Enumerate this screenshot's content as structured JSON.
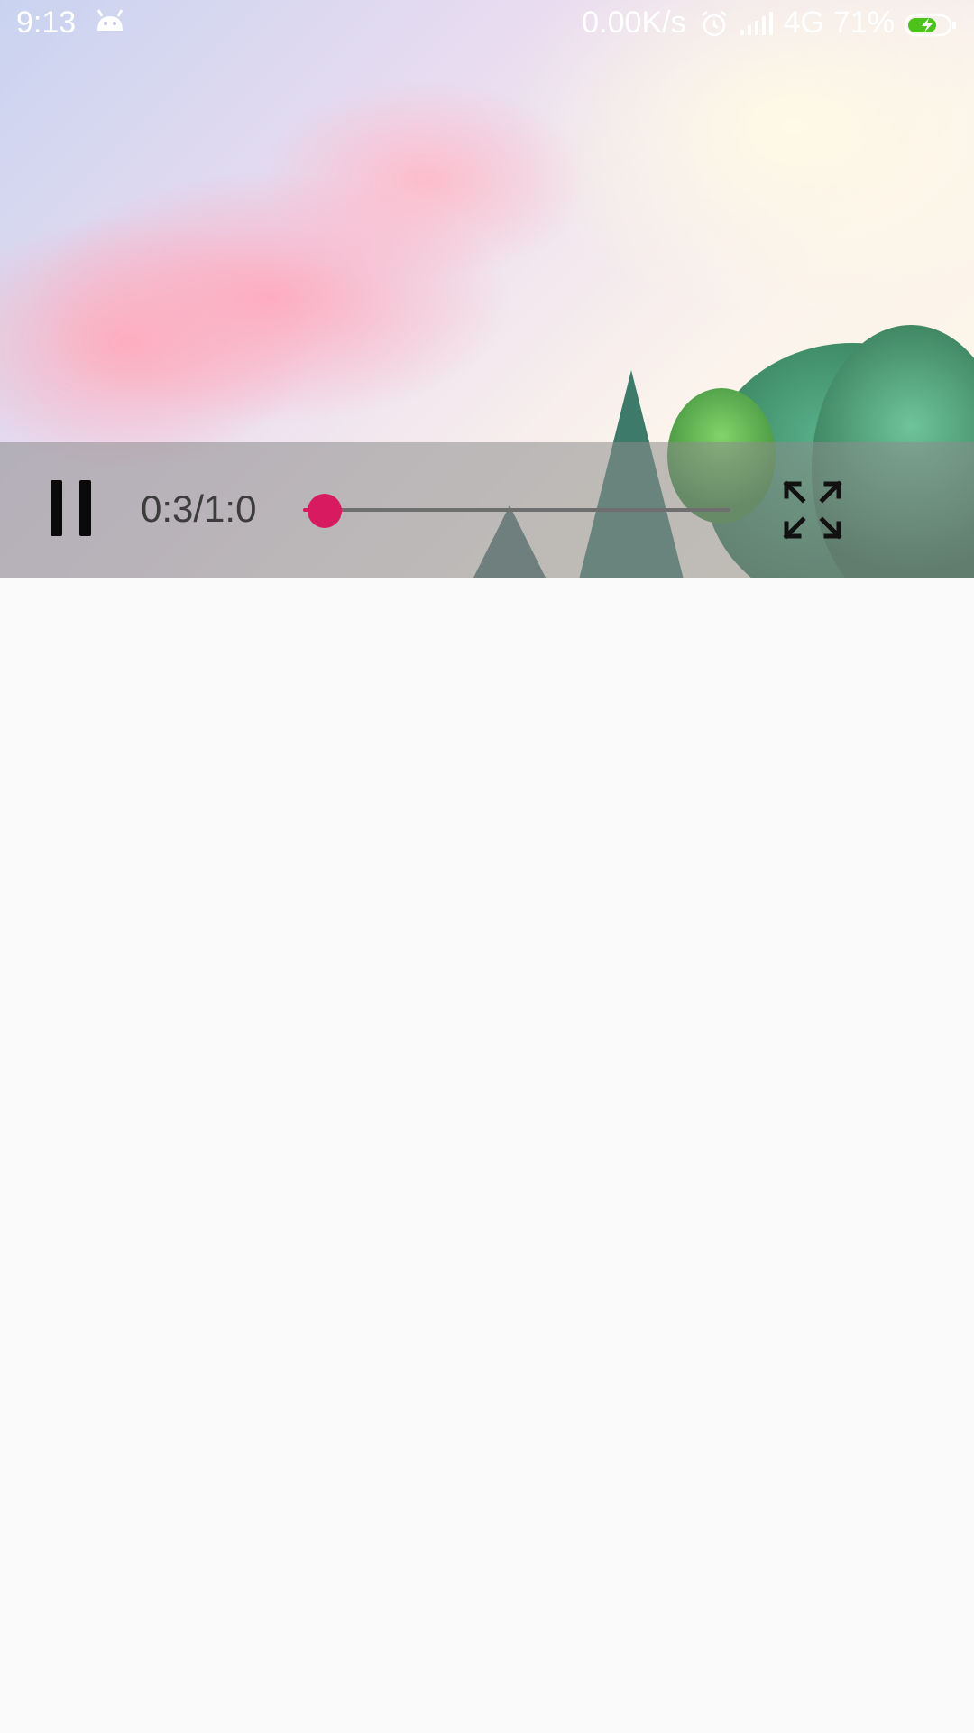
{
  "status_bar": {
    "time": "9:13",
    "network_speed": "0.00K/s",
    "network_type": "4G",
    "battery_percent": "71%",
    "battery_level": 0.71,
    "charging": true,
    "icons": [
      "android-notification-icon",
      "alarm-icon",
      "signal-icon",
      "battery-charging-icon"
    ]
  },
  "player": {
    "time_display": "0:3/1:0",
    "progress": 0.05,
    "play_state_icon": "pause-icon",
    "fullscreen_icon": "fullscreen-expand-icon",
    "colors": {
      "accent": "#d81b60",
      "controls_overlay": "#8c8c8c",
      "track": "#6f6f6f"
    }
  }
}
